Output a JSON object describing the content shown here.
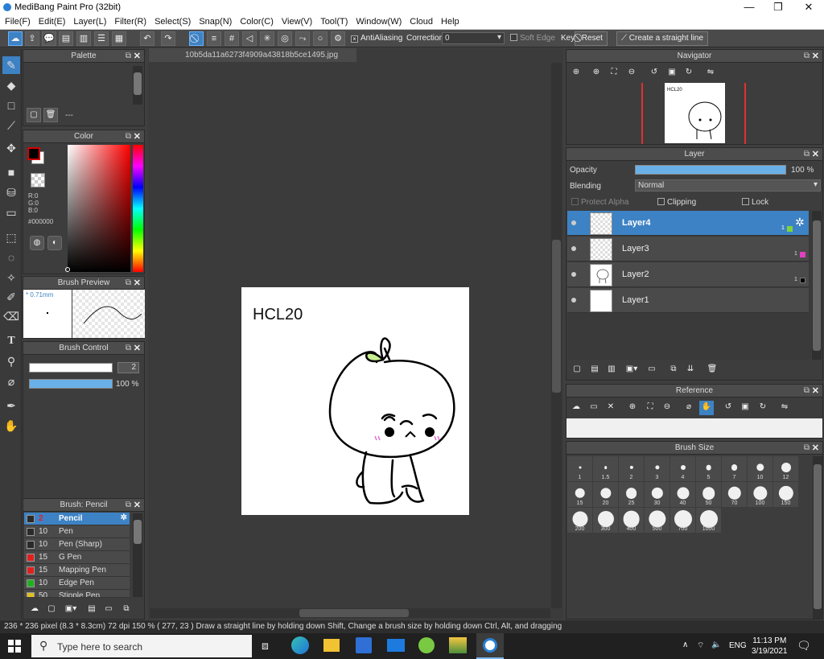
{
  "window": {
    "title": "MediBang Paint Pro (32bit)",
    "minimize": "—",
    "maximize": "❐",
    "close": "✕"
  },
  "menu": [
    "File(F)",
    "Edit(E)",
    "Layer(L)",
    "Filter(R)",
    "Select(S)",
    "Snap(N)",
    "Color(C)",
    "View(V)",
    "Tool(T)",
    "Window(W)",
    "Cloud",
    "Help"
  ],
  "toolbar": {
    "antialiasing": "AntiAliasing",
    "correction_label": "Correction",
    "correction_value": "0",
    "soft_edge": "Soft Edge",
    "key": "Key",
    "reset": "Reset",
    "straight_line": "Create a straight line"
  },
  "tools": [
    "brush-icon",
    "eraser-icon",
    "rectangle-icon",
    "line-icon",
    "move-icon",
    "fill-rect-icon",
    "bucket-icon",
    "gradient-icon",
    "select-rect-icon",
    "lasso-icon",
    "magic-wand-icon",
    "select-pen-icon",
    "select-eraser-icon",
    "text-icon",
    "operation-icon",
    "eyedropper-icon",
    "dropper-icon",
    "hand-icon"
  ],
  "palette": {
    "title": "Palette",
    "value": "---"
  },
  "color": {
    "title": "Color",
    "r": "R:0",
    "g": "G:0",
    "b": "B:0",
    "hex": "#000000",
    "fg": "#000000",
    "bg": "#ffffff",
    "accent_red": "#d40000"
  },
  "brush_preview": {
    "title": "Brush Preview",
    "size": "0.71mm"
  },
  "brush_control": {
    "title": "Brush Control",
    "size_value": "2",
    "opacity_value": "100 %"
  },
  "brush_list": {
    "title": "Brush: Pencil",
    "items": [
      {
        "size": "2",
        "name": "Pencil",
        "color": "#2a2a2a"
      },
      {
        "size": "10",
        "name": "Pen",
        "color": "#2a2a2a"
      },
      {
        "size": "10",
        "name": "Pen (Sharp)",
        "color": "#2a2a2a"
      },
      {
        "size": "15",
        "name": "G Pen",
        "color": "#e02020"
      },
      {
        "size": "15",
        "name": "Mapping Pen",
        "color": "#e02020"
      },
      {
        "size": "10",
        "name": "Edge Pen",
        "color": "#20b020"
      },
      {
        "size": "50",
        "name": "Stipple Pen",
        "color": "#e0c020"
      }
    ]
  },
  "document": {
    "filename": "10b5da11a6273f4909a43818b5ce1495.jpg",
    "drawing_text": "HCL20"
  },
  "navigator": {
    "title": "Navigator"
  },
  "layer_panel": {
    "title": "Layer",
    "opacity_label": "Opacity",
    "opacity_value": "100 %",
    "blending_label": "Blending",
    "blending_value": "Normal",
    "protect_alpha": "Protect Alpha",
    "clipping": "Clipping",
    "lock": "Lock",
    "layers": [
      {
        "name": "Layer4",
        "badge": "1",
        "badge_color": "#7fd43a"
      },
      {
        "name": "Layer3",
        "badge": "1",
        "badge_color": "#e040c0"
      },
      {
        "name": "Layer2",
        "badge": "1",
        "badge_color": "#000000"
      },
      {
        "name": "Layer1",
        "badge": "",
        "badge_color": ""
      }
    ]
  },
  "reference": {
    "title": "Reference"
  },
  "brush_size": {
    "title": "Brush Size",
    "sizes": [
      "1",
      "1.5",
      "2",
      "3",
      "4",
      "5",
      "7",
      "10",
      "12",
      "15",
      "20",
      "25",
      "30",
      "40",
      "50",
      "70",
      "100",
      "150",
      "200",
      "300",
      "400",
      "500",
      "700",
      "1000"
    ]
  },
  "status": "236 * 236 pixel  (8.3 * 8.3cm)  72 dpi  150 %  ( 277, 23 )  Draw a straight line by holding down Shift, Change a brush size by holding down Ctrl, Alt, and dragging",
  "taskbar": {
    "search_placeholder": "Type here to search",
    "lang": "ENG",
    "time": "11:13 PM",
    "date": "3/19/2021"
  }
}
